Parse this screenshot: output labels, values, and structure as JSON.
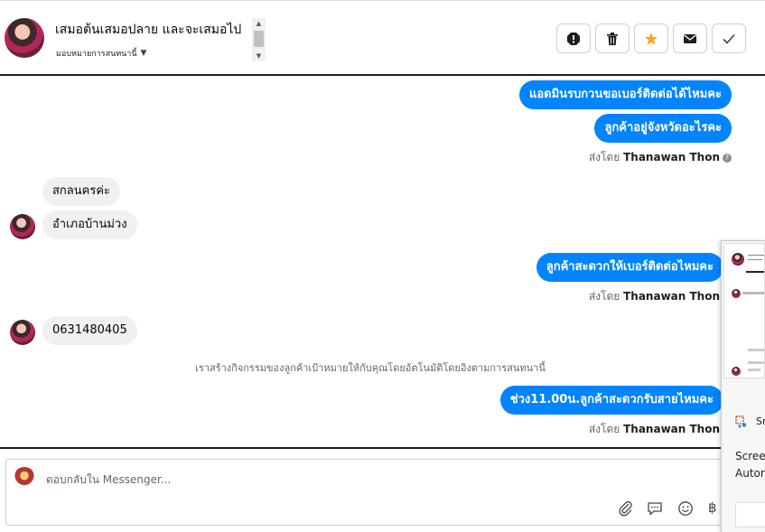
{
  "header": {
    "title": "เสมอต้นเสมอปลาย และจะเสมอไป",
    "assign_label": "มอบหมายการสนทนานี้",
    "tools": [
      {
        "name": "report-icon",
        "label": "!"
      },
      {
        "name": "trash-icon"
      },
      {
        "name": "star-icon"
      },
      {
        "name": "mail-icon"
      },
      {
        "name": "check-icon"
      }
    ],
    "colors": {
      "star": "#f5a623",
      "border": "#1c1e21"
    }
  },
  "conversation": {
    "messages": [
      {
        "side": "out",
        "text": "แอดมินรบกวนขอเบอร์ติดต่อได้ไหมคะ"
      },
      {
        "side": "out",
        "text": "ลูกค้าอยู่จังหวัดอะไรคะ"
      },
      {
        "side": "meta",
        "prefix": "ส่งโดย",
        "sender": "Thanawan Thon"
      },
      {
        "side": "in",
        "text": "สกลนครค่ะ"
      },
      {
        "side": "in",
        "text": "อำเภอบ้านม่วง"
      },
      {
        "side": "out",
        "text": "ลูกค้าสะดวกให้เบอร์ติดต่อไหมคะ"
      },
      {
        "side": "meta",
        "prefix": "ส่งโดย",
        "sender": "Thanawan Thon"
      },
      {
        "side": "in",
        "text": "0631480405"
      },
      {
        "side": "system",
        "text": "เราสร้างกิจกรรมของลูกค้าเป้าหมายให้กับคุณโดยอัตโนมัติโดยอิงตามการสนทนานี้"
      },
      {
        "side": "out",
        "text": "ช่วง11.00น.ลูกค้าสะดวกรับสายไหมคะ"
      },
      {
        "side": "meta",
        "prefix": "ส่งโดย",
        "sender": "Thanawan Thon"
      }
    ],
    "colors": {
      "outgoing": "#0084ff",
      "incoming": "#f0f0f0"
    }
  },
  "composer": {
    "placeholder": "ตอบกลับใน Messenger...",
    "icons": [
      "attachment-icon",
      "saved-reply-icon",
      "emoji-icon",
      "payment-icon"
    ],
    "baht_symbol": "฿"
  },
  "side_panel": {
    "snip_label": "Sn",
    "line1": "Scree",
    "line2": "Autor"
  }
}
